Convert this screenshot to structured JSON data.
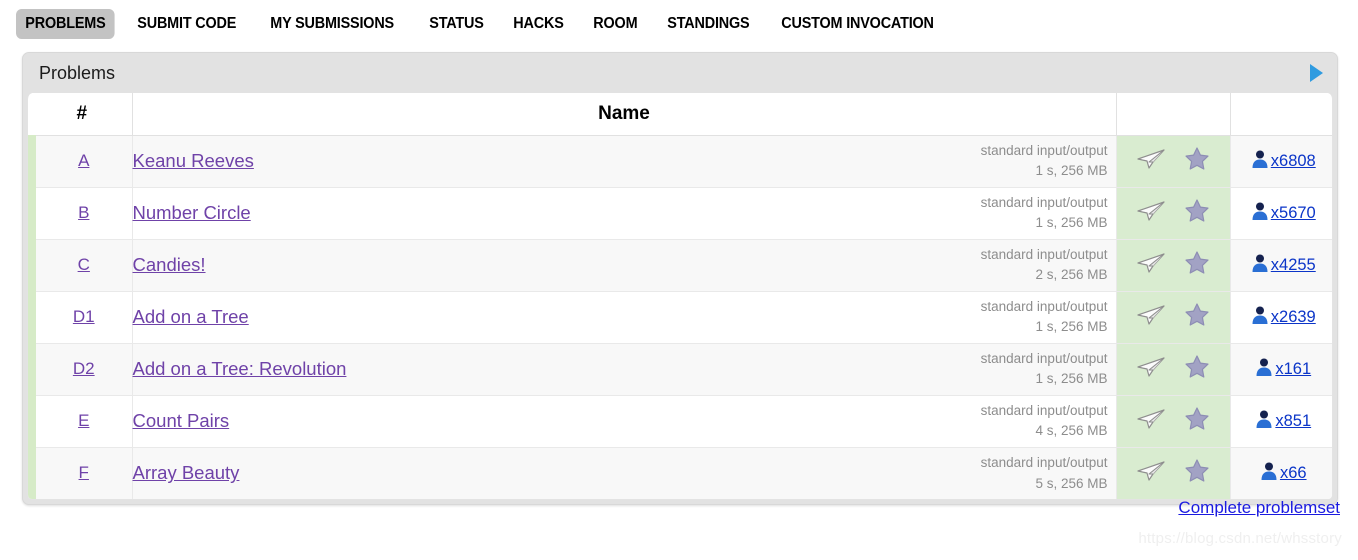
{
  "nav": {
    "items": [
      {
        "label": "PROBLEMS",
        "active": true
      },
      {
        "label": "SUBMIT CODE",
        "active": false
      },
      {
        "label": "MY SUBMISSIONS",
        "active": false
      },
      {
        "label": "STATUS",
        "active": false
      },
      {
        "label": "HACKS",
        "active": false
      },
      {
        "label": "ROOM",
        "active": false
      },
      {
        "label": "STANDINGS",
        "active": false
      },
      {
        "label": "CUSTOM INVOCATION",
        "active": false
      }
    ]
  },
  "panel": {
    "title": "Problems",
    "toggle_icon": "caret-right-icon"
  },
  "table": {
    "headers": {
      "index": "#",
      "name": "Name",
      "actions": "",
      "count": ""
    },
    "rows": [
      {
        "index": "A",
        "name": "Keanu Reeves",
        "io": "standard input/output",
        "limits": "1 s, 256 MB",
        "solved": "x6808"
      },
      {
        "index": "B",
        "name": "Number Circle",
        "io": "standard input/output",
        "limits": "1 s, 256 MB",
        "solved": "x5670"
      },
      {
        "index": "C",
        "name": "Candies!",
        "io": "standard input/output",
        "limits": "2 s, 256 MB",
        "solved": "x4255"
      },
      {
        "index": "D1",
        "name": "Add on a Tree",
        "io": "standard input/output",
        "limits": "1 s, 256 MB",
        "solved": "x2639"
      },
      {
        "index": "D2",
        "name": "Add on a Tree: Revolution",
        "io": "standard input/output",
        "limits": "1 s, 256 MB",
        "solved": "x161"
      },
      {
        "index": "E",
        "name": "Count Pairs",
        "io": "standard input/output",
        "limits": "4 s, 256 MB",
        "solved": "x851"
      },
      {
        "index": "F",
        "name": "Array Beauty",
        "io": "standard input/output",
        "limits": "5 s, 256 MB",
        "solved": "x66"
      }
    ]
  },
  "footer": {
    "complete_problemset": "Complete problemset",
    "watermark": "https://blog.csdn.net/whsstory"
  },
  "colors": {
    "link_purple": "#6f42a8",
    "link_blue": "#0b35c8",
    "accent_green": "#d9ecd0",
    "side_green": "#d6ebc7",
    "caption_gray": "#e2e2e2",
    "active_tab_gray": "#c3c3c3",
    "caret_blue": "#2f9be0"
  },
  "icons": {
    "submit": "paper-plane-icon",
    "favorite": "star-icon",
    "solvers": "user-icon"
  }
}
